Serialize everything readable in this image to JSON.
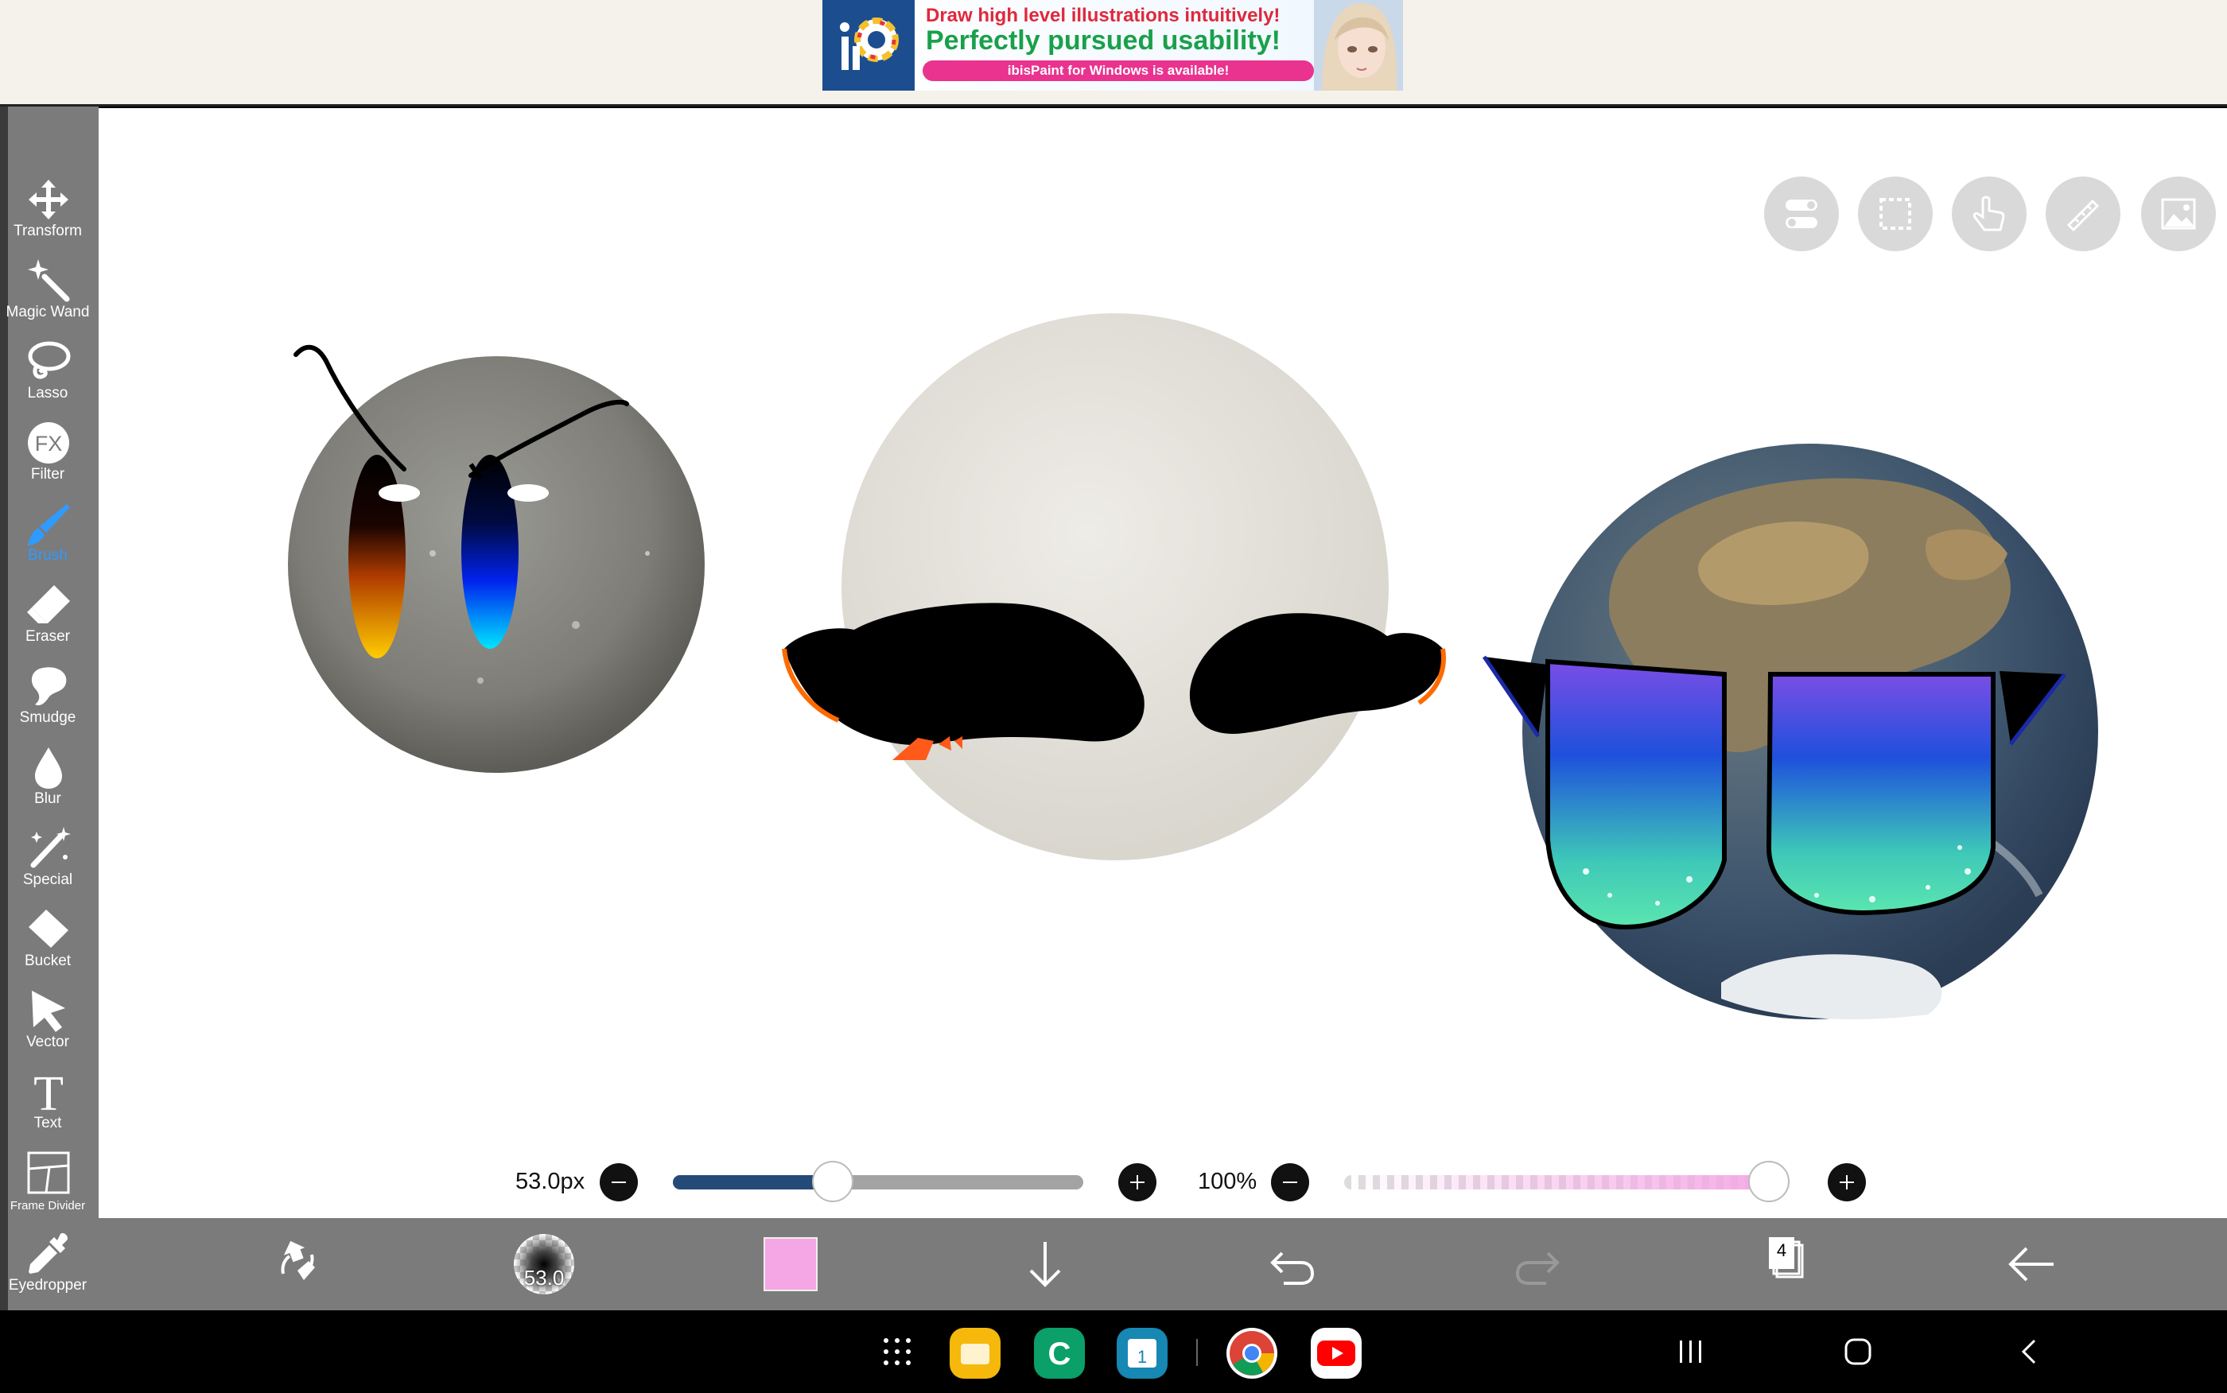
{
  "ad": {
    "line1": "Draw high level illustrations intuitively!",
    "line2": "Perfectly pursued usability!",
    "line3": "ibisPaint for Windows is available!"
  },
  "tools": [
    {
      "id": "transform",
      "label": "Transform",
      "icon": "move-arrows-icon"
    },
    {
      "id": "magic-wand",
      "label": "Magic Wand",
      "icon": "magic-wand-icon"
    },
    {
      "id": "lasso",
      "label": "Lasso",
      "icon": "lasso-icon"
    },
    {
      "id": "filter",
      "label": "Filter",
      "icon": "fx-icon"
    },
    {
      "id": "brush",
      "label": "Brush",
      "icon": "brush-icon",
      "active": true
    },
    {
      "id": "eraser",
      "label": "Eraser",
      "icon": "eraser-icon"
    },
    {
      "id": "smudge",
      "label": "Smudge",
      "icon": "smudge-icon"
    },
    {
      "id": "blur",
      "label": "Blur",
      "icon": "blur-drop-icon"
    },
    {
      "id": "special",
      "label": "Special",
      "icon": "special-icon"
    },
    {
      "id": "bucket",
      "label": "Bucket",
      "icon": "bucket-icon"
    },
    {
      "id": "vector",
      "label": "Vector",
      "icon": "vector-arrow-icon"
    },
    {
      "id": "text",
      "label": "Text",
      "icon": "text-t-icon"
    },
    {
      "id": "frame-divider",
      "label": "Frame Divider",
      "icon": "frame-divider-icon"
    },
    {
      "id": "eyedropper",
      "label": "Eyedropper",
      "icon": "eyedropper-icon"
    }
  ],
  "top_buttons": [
    "toggle-icon",
    "selection-icon",
    "touch-hand-icon",
    "ruler-icon",
    "image-icon"
  ],
  "brush": {
    "size_label": "53.0px",
    "size_fraction": 0.39,
    "opacity_label": "100%",
    "opacity_fraction": 1.0,
    "preview_label": "53.0"
  },
  "colors": {
    "current": "#f4a7e4",
    "accent": "#2f9bff",
    "slider_fill": "#244a78"
  },
  "layers": {
    "count": "4"
  }
}
